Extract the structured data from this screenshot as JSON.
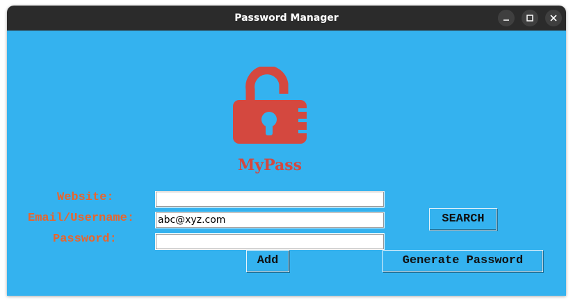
{
  "window": {
    "title": "Password Manager",
    "controls": {
      "minimize": "minimize-icon",
      "maximize": "maximize-icon",
      "close": "close-icon"
    }
  },
  "logo": {
    "icon": "padlock-open-icon",
    "brand_text": "MyPass",
    "color": "#d4483f"
  },
  "form": {
    "website": {
      "label": "Website:",
      "value": ""
    },
    "email": {
      "label": "Email/Username:",
      "value": "abc@xyz.com"
    },
    "password": {
      "label": "Password:",
      "value": ""
    }
  },
  "buttons": {
    "search": "SEARCH",
    "add": "Add",
    "generate": "Generate Password"
  },
  "colors": {
    "background": "#34b2ef",
    "label": "#e8652d",
    "titlebar": "#2b2b2b"
  }
}
